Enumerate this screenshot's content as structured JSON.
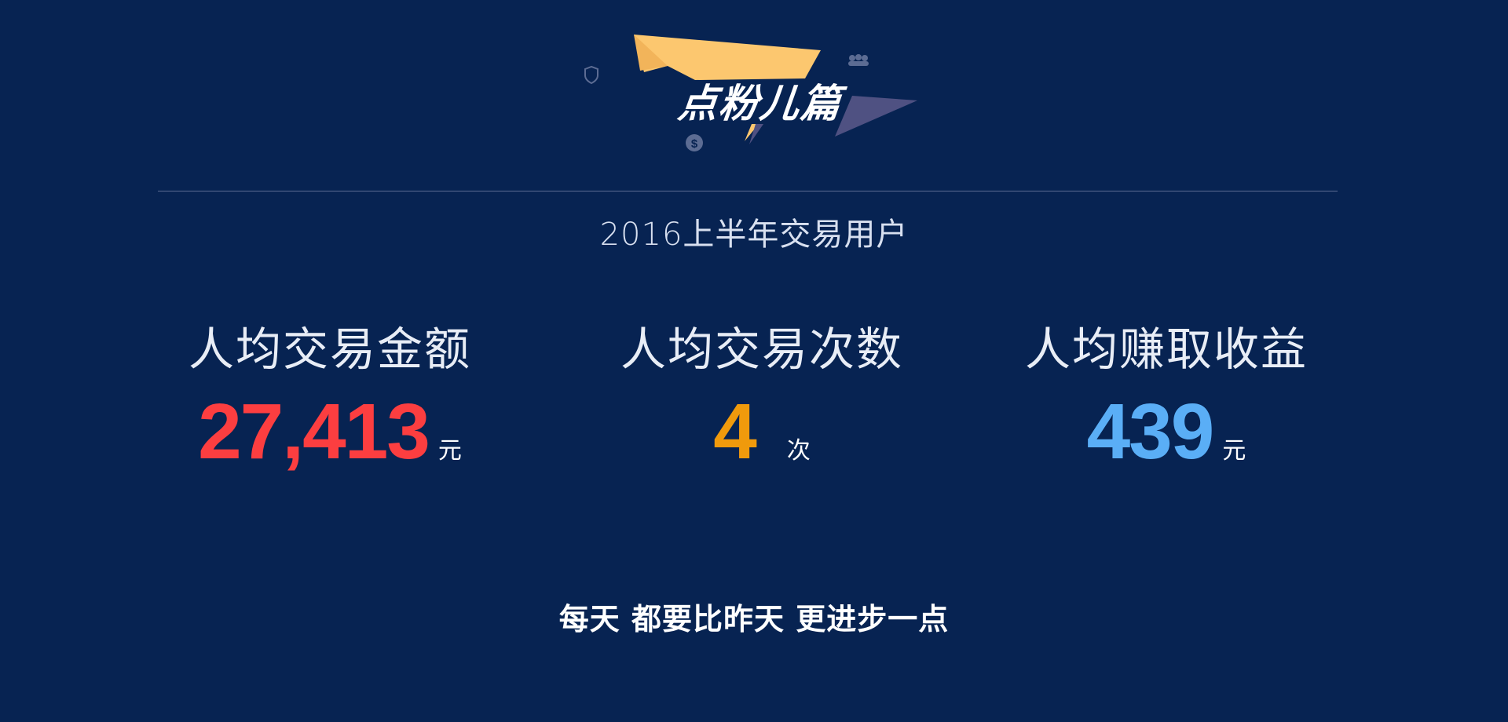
{
  "colors": {
    "background": "#072352",
    "banner_yellow": "#fcc76f",
    "banner_purple": "#4f5182",
    "amount_red": "#fc3e40",
    "count_orange": "#f09a0c",
    "income_blue": "#5aaef6"
  },
  "banner": {
    "title": "点粉儿篇",
    "icons": [
      "shield-icon",
      "people-icon",
      "dollar-coin-icon"
    ]
  },
  "subtitle": "2016上半年交易用户",
  "stats": [
    {
      "label": "人均交易金额",
      "value": "27,413",
      "unit": "元",
      "color": "#fc3e40"
    },
    {
      "label": "人均交易次数",
      "value": "4",
      "unit": "次",
      "color": "#f09a0c"
    },
    {
      "label": "人均赚取收益",
      "value": "439",
      "unit": "元",
      "color": "#5aaef6"
    }
  ],
  "slogan": "每天 都要比昨天 更进步一点"
}
